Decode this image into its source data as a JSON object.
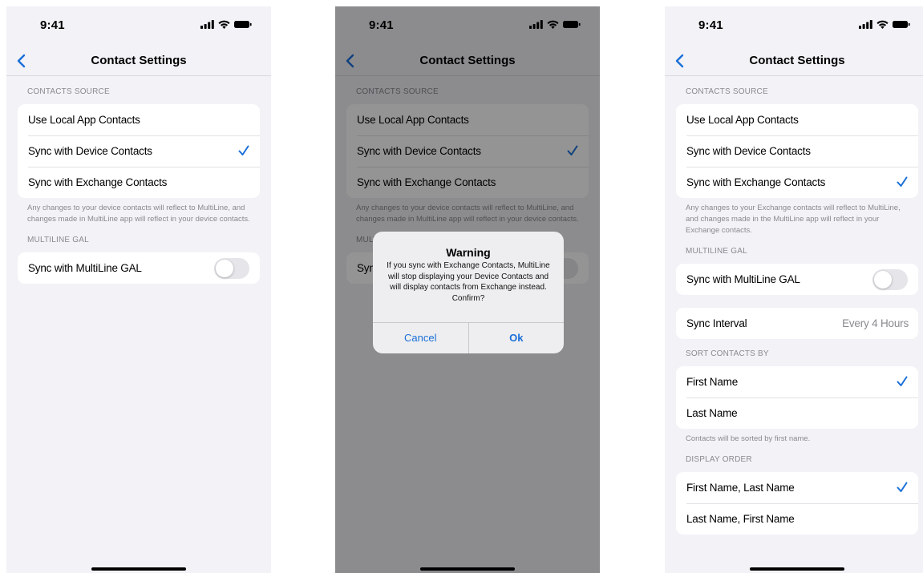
{
  "status_bar": {
    "time": "9:41"
  },
  "nav": {
    "title": "Contact Settings",
    "back_icon": "chevron-left-icon"
  },
  "colors": {
    "accent": "#1a6fd8",
    "background": "#f2f2f7",
    "secondary_text": "#8a8a8f"
  },
  "contacts_source": {
    "header": "CONTACTS SOURCE",
    "options": [
      "Use Local App Contacts",
      "Sync with Device Contacts",
      "Sync with Exchange Contacts"
    ]
  },
  "multiline_gal": {
    "header": "MULTILINE GAL",
    "label": "Sync with MultiLine GAL"
  },
  "screen1": {
    "selected_source": "Sync with Device Contacts",
    "footer": "Any changes to your device contacts will reflect to MultiLine, and changes made in MultiLine app will reflect in your device contacts.",
    "gal_toggle_on": false
  },
  "screen2": {
    "selected_source": "Sync with Device Contacts",
    "footer": "Any changes to your device contacts will reflect to MultiLine, and changes made in MultiLine app will reflect in your device contacts.",
    "gal_toggle_on": false,
    "alert": {
      "title": "Warning",
      "message": "If you sync with Exchange Contacts, MultiLine will stop displaying your Device Contacts and will display contacts from Exchange instead. Confirm?",
      "cancel": "Cancel",
      "ok": "Ok"
    }
  },
  "screen3": {
    "selected_source": "Sync with Exchange Contacts",
    "footer": "Any changes to your Exchange contacts will reflect to MultiLine, and changes made in the MultiLine app will reflect in your Exchange contacts.",
    "gal_toggle_on": false,
    "sync_interval": {
      "label": "Sync Interval",
      "value": "Every 4 Hours"
    },
    "sort": {
      "header": "SORT CONTACTS BY",
      "options": [
        "First Name",
        "Last Name"
      ],
      "selected": "First Name",
      "footer": "Contacts will be sorted by first name."
    },
    "display_order": {
      "header": "DISPLAY ORDER",
      "options": [
        "First Name, Last Name",
        "Last Name, First Name"
      ],
      "selected": "First Name, Last Name"
    }
  }
}
